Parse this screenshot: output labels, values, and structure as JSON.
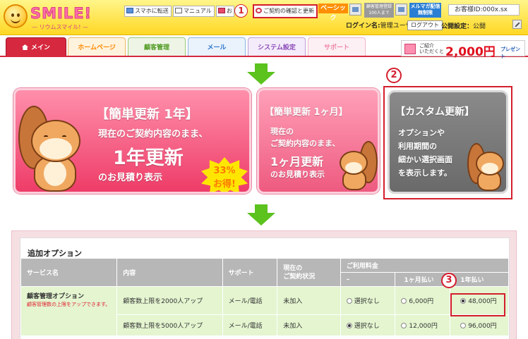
{
  "header": {
    "logo_text": "SMILE!",
    "logo_sub": "— リウムスマイル! —",
    "buttons": {
      "to_phone": "スマホに転送",
      "manual": "マニュアル",
      "inquiry": "お",
      "contract": "ご契約の確認と更新"
    },
    "plan": "ベーシック",
    "customer_limit": "顧客管理登録\n100人まで",
    "mag_limit": "メルマガ配信\n無制限",
    "account": "お客様ID:000x.sx",
    "login_label": "ログイン名:",
    "login_name": "管理ユーザー 様",
    "logout": "ログアウト",
    "publish_label": "公開設定：",
    "publish_value": "公開"
  },
  "nav": {
    "tabs": [
      "メイン",
      "ホームページ",
      "顧客管理",
      "メール",
      "システム設定",
      "サポート"
    ]
  },
  "promo": {
    "small": "ご紹介\nいただくと",
    "amount": "2,000円",
    "suffix": "プレゼント"
  },
  "annotations": [
    "1",
    "2",
    "3"
  ],
  "panels": {
    "one_year": {
      "title": "【簡単更新 1年】",
      "line1": "現在のご契約内容のまま、",
      "big": "1年更新",
      "line3": "のお見積り表示",
      "badge_pct": "33%",
      "badge_label": "お得!"
    },
    "one_month": {
      "title": "【簡単更新 1ヶ月】",
      "line1": "現在の",
      "line2": "ご契約内容のまま、",
      "big": "1ヶ月更新",
      "line4": "のお見積り表示"
    },
    "custom": {
      "title": "【カスタム更新】",
      "line1": "オプションや",
      "line2": "利用期間の",
      "line3": "細かい選択画面",
      "line4": "を表示します。"
    }
  },
  "options": {
    "heading": "追加オプション",
    "headers": {
      "service": "サービス名",
      "content": "内容",
      "support": "サポート",
      "status": "現在の\nご契約状況",
      "fee": "ご利用料金",
      "none": "–",
      "monthly": "1ヶ月払い",
      "yearly": "1年払い"
    },
    "rows": [
      {
        "service": "顧客管理オプション",
        "note": "顧客管理数の上限をアップできます。",
        "content": "顧客数上限を2000人アップ",
        "support": "メール/電話",
        "status": "未加入",
        "none": "選択なし",
        "monthly": "6,000円",
        "yearly": "48,000円",
        "selected": "yearly"
      },
      {
        "service": "",
        "note": "",
        "content": "顧客数上限を5000人アップ",
        "support": "メール/電話",
        "status": "未加入",
        "none": "選択なし",
        "monthly": "12,000円",
        "yearly": "96,000円",
        "selected": "none"
      }
    ]
  }
}
